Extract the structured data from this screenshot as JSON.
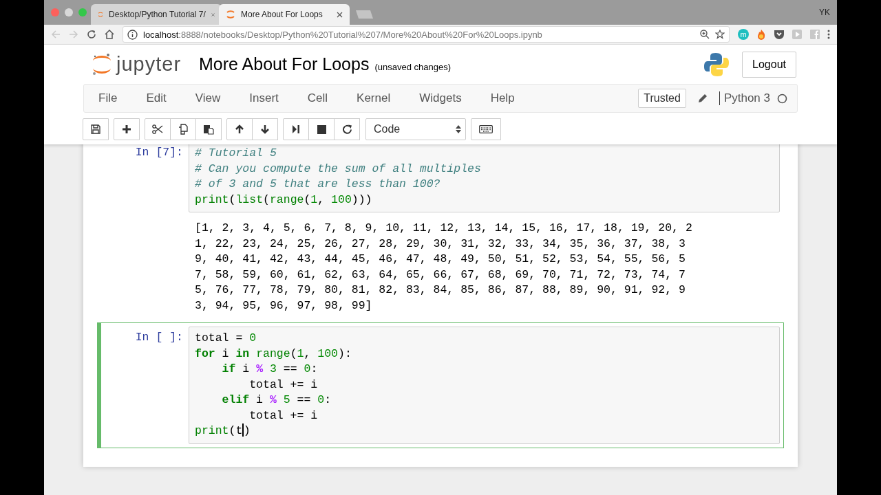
{
  "browser": {
    "tabs": [
      {
        "label": "Desktop/Python Tutorial 7/",
        "selected": false
      },
      {
        "label": "More About For Loops",
        "selected": true
      }
    ],
    "profile": "YK",
    "address": {
      "host": "localhost",
      "path": ":8888/notebooks/Desktop/Python%20Tutorial%207/More%20About%20For%20Loops.ipynb"
    },
    "extension_badge": "m"
  },
  "header": {
    "logo_text": "jupyter",
    "notebook_title": "More About For Loops",
    "save_status": "(unsaved changes)",
    "logout": "Logout"
  },
  "menu": {
    "items": [
      "File",
      "Edit",
      "View",
      "Insert",
      "Cell",
      "Kernel",
      "Widgets",
      "Help"
    ],
    "trusted": "Trusted",
    "kernel": "Python 3"
  },
  "toolbar": {
    "cell_type": "Code"
  },
  "cells": [
    {
      "prompt": "In [7]:",
      "selected": false,
      "code": [
        [
          {
            "kind": "comment",
            "text": "# Tutorial 5"
          }
        ],
        [
          {
            "kind": "comment",
            "text": "# Can you compute the sum of all multiples"
          }
        ],
        [
          {
            "kind": "comment",
            "text": "# of 3 and 5 that are less than 100?"
          }
        ],
        [
          {
            "kind": "builtin",
            "text": "print"
          },
          {
            "kind": "plain",
            "text": "("
          },
          {
            "kind": "builtin",
            "text": "list"
          },
          {
            "kind": "plain",
            "text": "("
          },
          {
            "kind": "builtin",
            "text": "range"
          },
          {
            "kind": "plain",
            "text": "("
          },
          {
            "kind": "number",
            "text": "1"
          },
          {
            "kind": "plain",
            "text": ", "
          },
          {
            "kind": "number",
            "text": "100"
          },
          {
            "kind": "plain",
            "text": ")))"
          }
        ]
      ],
      "output": [
        "[1, 2, 3, 4, 5, 6, 7, 8, 9, 10, 11, 12, 13, 14, 15, 16, 17, 18, 19, 20, 2",
        "1, 22, 23, 24, 25, 26, 27, 28, 29, 30, 31, 32, 33, 34, 35, 36, 37, 38, 3",
        "9, 40, 41, 42, 43, 44, 45, 46, 47, 48, 49, 50, 51, 52, 53, 54, 55, 56, 5",
        "7, 58, 59, 60, 61, 62, 63, 64, 65, 66, 67, 68, 69, 70, 71, 72, 73, 74, 7",
        "5, 76, 77, 78, 79, 80, 81, 82, 83, 84, 85, 86, 87, 88, 89, 90, 91, 92, 9",
        "3, 94, 95, 96, 97, 98, 99]"
      ]
    },
    {
      "prompt": "In [ ]:",
      "selected": true,
      "code": [
        [
          {
            "kind": "plain",
            "text": "total = "
          },
          {
            "kind": "number",
            "text": "0"
          }
        ],
        [
          {
            "kind": "keyword",
            "text": "for"
          },
          {
            "kind": "plain",
            "text": " i "
          },
          {
            "kind": "keyword",
            "text": "in"
          },
          {
            "kind": "builtin",
            "text": " range"
          },
          {
            "kind": "plain",
            "text": "("
          },
          {
            "kind": "number",
            "text": "1"
          },
          {
            "kind": "plain",
            "text": ", "
          },
          {
            "kind": "number",
            "text": "100"
          },
          {
            "kind": "plain",
            "text": "):"
          }
        ],
        [
          {
            "kind": "keyword",
            "text": "    if"
          },
          {
            "kind": "plain",
            "text": " i "
          },
          {
            "kind": "operator",
            "text": "%"
          },
          {
            "kind": "number",
            "text": " 3"
          },
          {
            "kind": "plain",
            "text": " == "
          },
          {
            "kind": "number",
            "text": "0"
          },
          {
            "kind": "plain",
            "text": ":"
          }
        ],
        [
          {
            "kind": "plain",
            "text": "        total += i"
          }
        ],
        [
          {
            "kind": "keyword",
            "text": "    elif"
          },
          {
            "kind": "plain",
            "text": " i "
          },
          {
            "kind": "operator",
            "text": "%"
          },
          {
            "kind": "number",
            "text": " 5"
          },
          {
            "kind": "plain",
            "text": " == "
          },
          {
            "kind": "number",
            "text": "0"
          },
          {
            "kind": "plain",
            "text": ":"
          }
        ],
        [
          {
            "kind": "plain",
            "text": "        total += i"
          }
        ],
        [
          {
            "kind": "builtin",
            "text": "print"
          },
          {
            "kind": "plain",
            "text": "(t"
          },
          {
            "kind": "cursor"
          },
          {
            "kind": "plain",
            "text": ")"
          }
        ]
      ]
    }
  ]
}
